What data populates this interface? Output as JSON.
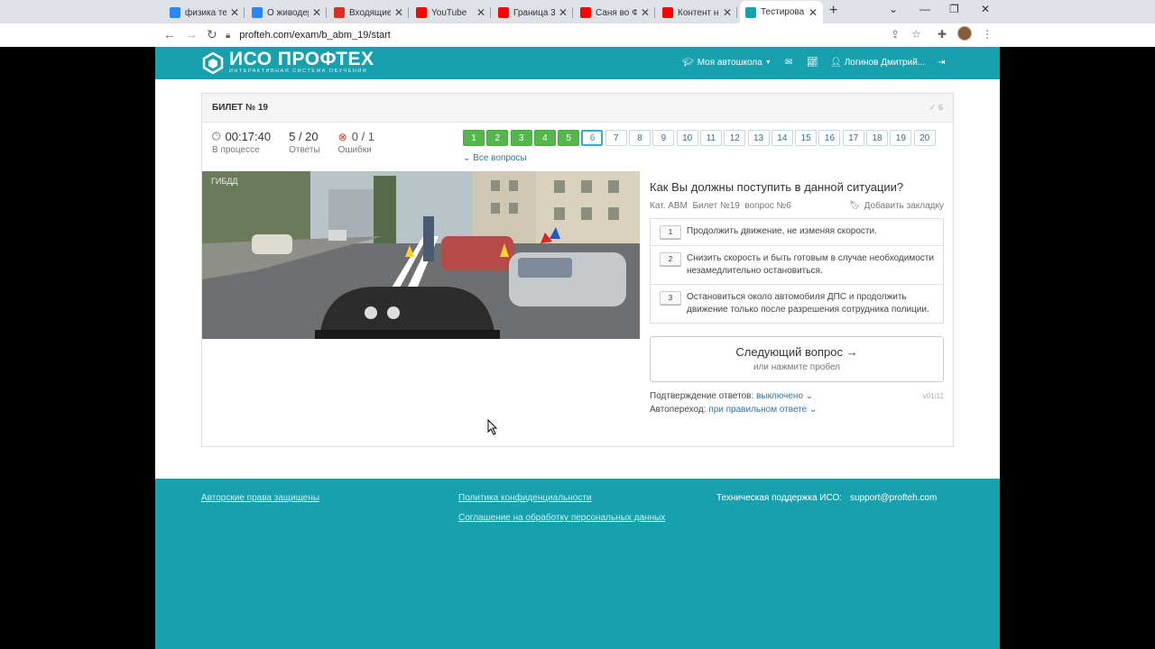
{
  "browser": {
    "tabs": [
      {
        "title": "физика тел",
        "favicon": "vk-icon",
        "color": "#2787f5"
      },
      {
        "title": "О живодер",
        "favicon": "vk-icon",
        "color": "#2787f5"
      },
      {
        "title": "Входящие",
        "favicon": "gmail-icon",
        "color": "#d93025"
      },
      {
        "title": "YouTube",
        "favicon": "youtube-icon",
        "color": "#ff0000"
      },
      {
        "title": "Граница 3",
        "favicon": "youtube-icon",
        "color": "#ff0000"
      },
      {
        "title": "Саня во Ф",
        "favicon": "youtube-icon",
        "color": "#ff0000"
      },
      {
        "title": "Контент н",
        "favicon": "youtube-icon",
        "color": "#ff0000"
      },
      {
        "title": "Тестирова",
        "favicon": "profteh-icon",
        "color": "#17a0ad",
        "active": true
      }
    ],
    "url": "profteh.com/exam/b_abm_19/start"
  },
  "header": {
    "logo_title": "ИСО ПРОФТЕХ",
    "logo_subtitle": "ИНТЕРАКТИВНАЯ СИСТЕМА ОБУЧЕНИЯ",
    "school_menu": "Моя автошкола",
    "user_name": "Логинов Дмитрий..."
  },
  "exam": {
    "ticket_title": "БИЛЕТ № 19",
    "check_count": "6",
    "timer": "00:17:40",
    "timer_label": "В процессе",
    "answers_value": "5 / 20",
    "answers_label": "Ответы",
    "errors_value": "0 / 1",
    "errors_label": "Ошибки",
    "question_numbers": [
      "1",
      "2",
      "3",
      "4",
      "5",
      "6",
      "7",
      "8",
      "9",
      "10",
      "11",
      "12",
      "13",
      "14",
      "15",
      "16",
      "17",
      "18",
      "19",
      "20"
    ],
    "completed_count": 5,
    "current_question": 6,
    "all_questions": "Все вопросы"
  },
  "question": {
    "title": "Как Вы должны поступить в данной ситуации?",
    "category": "Кат. ABM",
    "ticket": "Билет №19",
    "number": "вопрос №6",
    "bookmark": "Добавить закладку",
    "image_watermark": "ГИБДД",
    "answers": [
      {
        "num": "1",
        "text": "Продолжить движение, не изменяя скорости."
      },
      {
        "num": "2",
        "text": "Снизить скорость и быть готовым в случае необходимости незамедлительно остановиться."
      },
      {
        "num": "3",
        "text": "Остановиться около автомобиля ДПС и продолжить движение только после разрешения сотрудника полиции."
      }
    ]
  },
  "next_button": {
    "label": "Следующий вопрос →",
    "hint": "или нажмите пробел"
  },
  "settings": {
    "confirm_label": "Подтверждение ответов:",
    "confirm_value": "выключено",
    "auto_label": "Автопереход:",
    "auto_value": "при правильном ответе",
    "version": "v01/11"
  },
  "footer": {
    "copyright": "Авторские права защищены",
    "privacy": "Политика конфиденциальности",
    "consent": "Соглашение на обработку персональных данных",
    "support_label": "Техническая поддержка ИСО:",
    "support_email": "support@profteh.com"
  }
}
